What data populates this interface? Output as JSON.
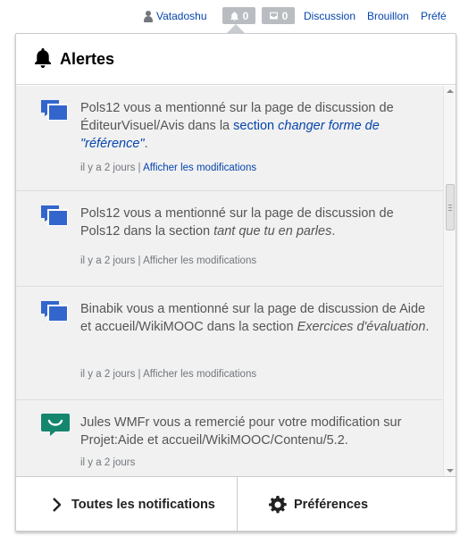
{
  "topbar": {
    "username": "Vatadoshu",
    "alerts_count": "0",
    "notices_count": "0",
    "links": [
      "Discussion",
      "Brouillon",
      "Préfé"
    ],
    "user_icon": "user-icon",
    "alerts_icon": "bell-icon",
    "notices_icon": "tray-icon"
  },
  "popup": {
    "title": "Alertes",
    "title_icon": "bell-icon",
    "notifications": [
      {
        "icon": "mention-icon",
        "text_parts": [
          "Pols12 vous a mentionné sur la page de discussion de ÉditeurVisuel/Avis dans la ",
          "section ",
          "changer forme de \"référence\"",
          "."
        ],
        "time": "il y a 2 jours",
        "separator": " | ",
        "link": "Afficher les modifications"
      },
      {
        "icon": "mention-icon",
        "text_parts": [
          "Pols12 vous a mentionné sur la page de discussion de Pols12 dans la section ",
          "tant que tu en parles",
          "."
        ],
        "time": "il y a 2 jours",
        "separator": " | ",
        "link": "Afficher les modifications"
      },
      {
        "icon": "mention-icon",
        "text_parts": [
          "Binabik vous a mentionné sur la page de discussion de Aide et accueil/WikiMOOC dans la section ",
          "Exercices d'évaluation",
          "."
        ],
        "time": "il y a 2 jours",
        "separator": " | ",
        "link": "Afficher les modifications"
      },
      {
        "icon": "thanks-icon",
        "text": "Jules WMFr vous a remercié pour votre modification sur Projet:Aide et accueil/WikiMOOC/Contenu/5.2.",
        "time": "il y a 2 jours"
      }
    ],
    "footer": {
      "all_label": "Toutes les notifications",
      "all_icon": "chevron-right-icon",
      "prefs_label": "Préférences",
      "prefs_icon": "gear-icon"
    }
  },
  "colors": {
    "link": "#0645ad",
    "mention_icon": "#3366cc",
    "thanks_icon": "#14866d",
    "badge": "#b9bcc0",
    "item_bg": "#f1f1f1"
  }
}
